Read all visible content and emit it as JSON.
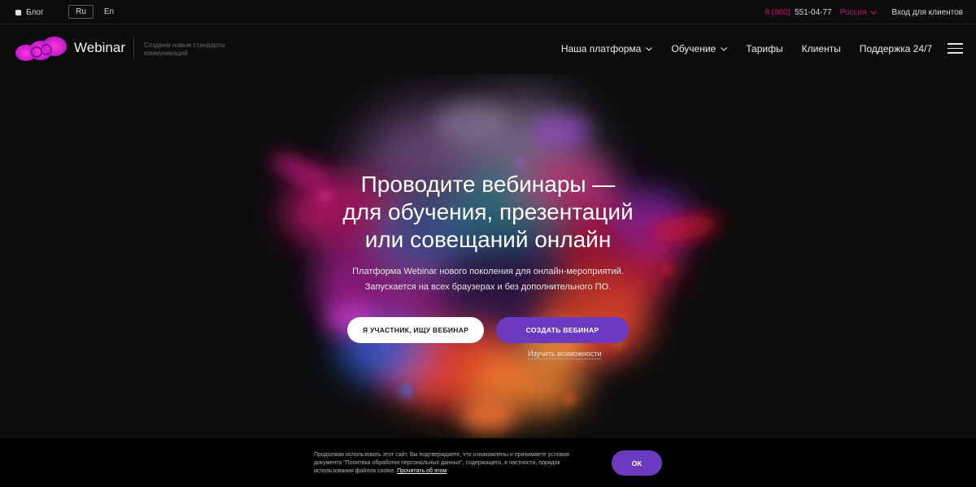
{
  "topbar": {
    "blog_label": "Блог",
    "lang_ru": "Ru",
    "lang_en": "En",
    "phone_code": "8 (800)",
    "phone_number": "551-04-77",
    "region": "Россия",
    "login": "Вход для клиентов"
  },
  "header": {
    "brand": "Webinar",
    "tagline": "Создаем новые стандарты коммуникаций",
    "nav": [
      {
        "label": "Наша платформа",
        "dropdown": true
      },
      {
        "label": "Обучение",
        "dropdown": true
      },
      {
        "label": "Тарифы",
        "dropdown": false
      },
      {
        "label": "Клиенты",
        "dropdown": false
      },
      {
        "label": "Поддержка 24/7",
        "dropdown": false
      }
    ]
  },
  "hero": {
    "title_line1": "Проводите вебинары —",
    "title_line2": "для обучения, презентаций",
    "title_line3": "или совещаний онлайн",
    "subtitle_line1": "Платформа Webinar нового поколения для онлайн-мероприятий.",
    "subtitle_line2": "Запускается на всех браузерах и без дополнительного ПО.",
    "participant_button": "Я УЧАСТНИК, ИЩУ ВЕБИНАР",
    "create_button": "СОЗДАТЬ ВЕБИНАР",
    "learn_link": "Изучить возможности"
  },
  "cookie": {
    "text": "Продолжая использовать этот сайт, Вы подтверждаете, что ознакомлены и принимаете условия документа \"Политика обработки персональных данных\", содержащего, в частности, порядок использования файлов cookie.",
    "link": "Прочитать об этом",
    "ok": "OK"
  },
  "colors": {
    "background": "#0c0c0d",
    "accent_purple": "#6b3ac0",
    "accent_pink": "#c2186b",
    "logo_magenta": "#d81bd0"
  },
  "icons": {
    "blog": "book-icon",
    "dropdown": "chevron-down-icon",
    "menu": "hamburger-menu-icon",
    "logo": "webinar-logo"
  }
}
